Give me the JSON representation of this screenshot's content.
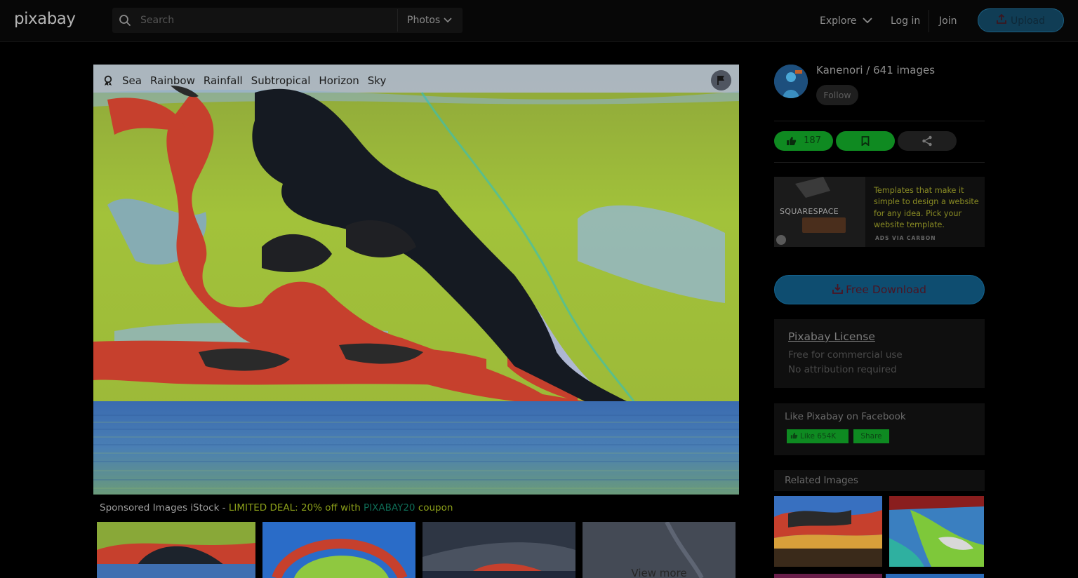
{
  "header": {
    "logo": "pixabay",
    "search_placeholder": "Search",
    "search_type": "Photos",
    "nav_explore": "Explore",
    "nav_login": "Log in",
    "nav_join": "Join",
    "upload_label": "Upload"
  },
  "image": {
    "tags": [
      "Sea",
      "Rainbow",
      "Rainfall",
      "Subtropical",
      "Horizon",
      "Sky"
    ]
  },
  "sponsored": {
    "prefix": "Sponsored Images iStock - ",
    "deal": "LIMITED DEAL: 20% off with ",
    "code": "PIXABAY20",
    "suffix": " coupon",
    "view_more": "View more"
  },
  "user": {
    "name_line": "Kanenori / 641 images",
    "follow_label": "Follow"
  },
  "actions": {
    "like_count": "187"
  },
  "ad": {
    "brand": "SQUARESPACE",
    "text": "Templates that make it simple to design a website for any idea. Pick your website template.",
    "via": "ADS VIA CARBON"
  },
  "download_label": "Free Download",
  "license": {
    "title": "Pixabay License",
    "line1": "Free for commercial use",
    "line2": "No attribution required"
  },
  "facebook": {
    "title": "Like Pixabay on Facebook",
    "like_label": "Like 654K",
    "share_label": "Share"
  },
  "related": {
    "title": "Related Images"
  }
}
